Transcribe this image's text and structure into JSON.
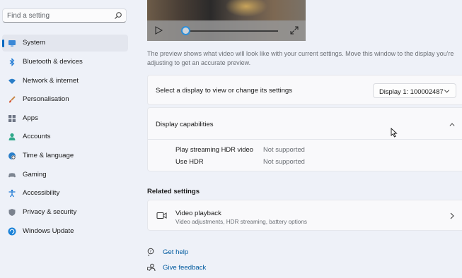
{
  "sidebar": {
    "search_placeholder": "Find a setting",
    "items": [
      {
        "label": "System",
        "icon": "monitor-icon",
        "selected": true
      },
      {
        "label": "Bluetooth & devices",
        "icon": "bluetooth-icon"
      },
      {
        "label": "Network & internet",
        "icon": "wifi-icon"
      },
      {
        "label": "Personalisation",
        "icon": "paintbrush-icon"
      },
      {
        "label": "Apps",
        "icon": "apps-icon"
      },
      {
        "label": "Accounts",
        "icon": "person-icon"
      },
      {
        "label": "Time & language",
        "icon": "globe-clock-icon"
      },
      {
        "label": "Gaming",
        "icon": "gamepad-icon"
      },
      {
        "label": "Accessibility",
        "icon": "accessibility-icon"
      },
      {
        "label": "Privacy & security",
        "icon": "shield-icon"
      },
      {
        "label": "Windows Update",
        "icon": "update-icon"
      }
    ]
  },
  "main": {
    "video_progress": 0.05,
    "preview_text": "The preview shows what video will look like with your current settings. Move this window to the display you're adjusting to get an accurate preview.",
    "display_select": {
      "label": "Select a display to view or change its settings",
      "value": "Display 1: 100002487"
    },
    "capabilities": {
      "title": "Display capabilities",
      "rows": [
        {
          "name": "Play streaming HDR video",
          "value": "Not supported"
        },
        {
          "name": "Use HDR",
          "value": "Not supported"
        }
      ]
    },
    "related": {
      "title": "Related settings",
      "item_title": "Video playback",
      "item_subtitle": "Video adjustments, HDR streaming, battery options"
    },
    "links": {
      "help": "Get help",
      "feedback": "Give feedback"
    }
  },
  "colors": {
    "accent": "#0067c0",
    "background": "#eef1f8",
    "card": "#f9f9fb",
    "link": "#005a9e"
  }
}
